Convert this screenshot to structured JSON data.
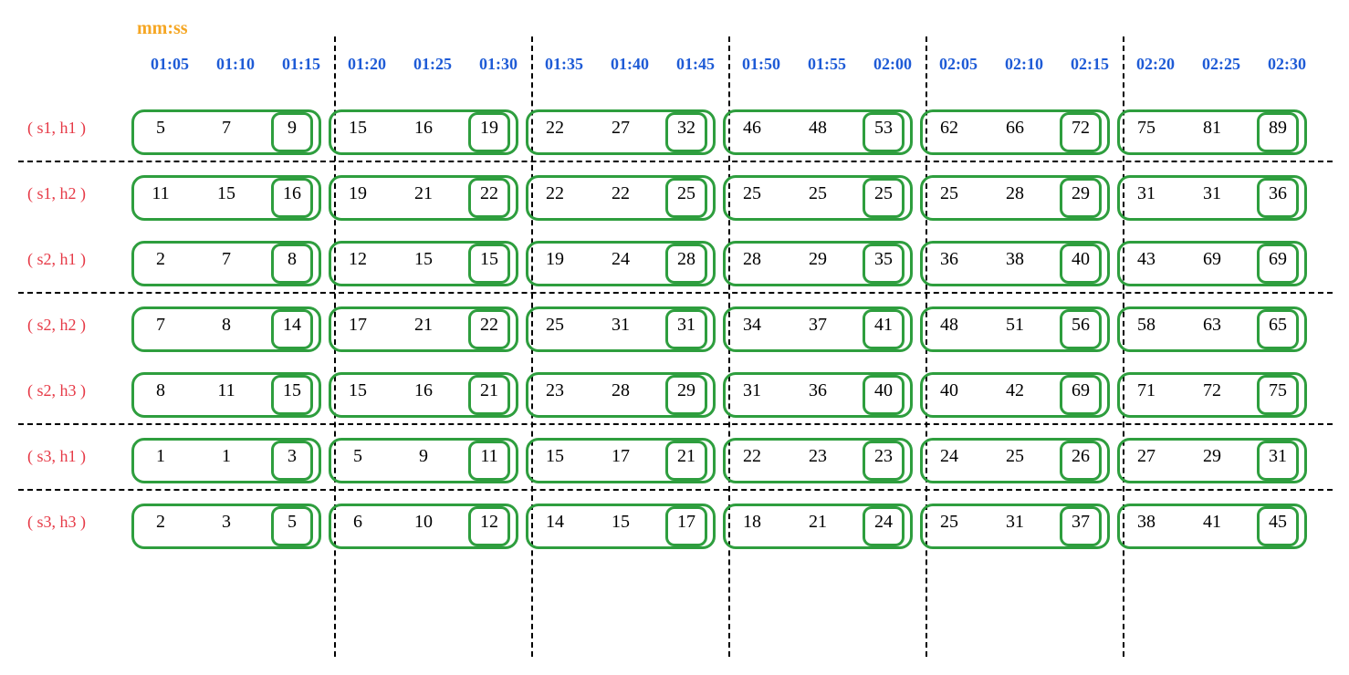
{
  "mmss_label": "mm:ss",
  "chart_data": {
    "type": "table",
    "title": "",
    "time_headers": [
      "01:05",
      "01:10",
      "01:15",
      "01:20",
      "01:25",
      "01:30",
      "01:35",
      "01:40",
      "01:45",
      "01:50",
      "01:55",
      "02:00",
      "02:05",
      "02:10",
      "02:15",
      "02:20",
      "02:25",
      "02:30"
    ],
    "rows": [
      {
        "label": "( s1, h1 )",
        "values": [
          5,
          7,
          9,
          15,
          16,
          19,
          22,
          27,
          32,
          46,
          48,
          53,
          62,
          66,
          72,
          75,
          81,
          89
        ]
      },
      {
        "label": "( s1, h2 )",
        "values": [
          11,
          15,
          16,
          19,
          21,
          22,
          22,
          22,
          25,
          25,
          25,
          25,
          25,
          28,
          29,
          31,
          31,
          36
        ]
      },
      {
        "label": "( s2, h1 )",
        "values": [
          2,
          7,
          8,
          12,
          15,
          15,
          19,
          24,
          28,
          28,
          29,
          35,
          36,
          38,
          40,
          43,
          69,
          69
        ]
      },
      {
        "label": "( s2, h2 )",
        "values": [
          7,
          8,
          14,
          17,
          21,
          22,
          25,
          31,
          31,
          34,
          37,
          41,
          48,
          51,
          56,
          58,
          63,
          65
        ]
      },
      {
        "label": "( s2, h3 )",
        "values": [
          8,
          11,
          15,
          15,
          16,
          21,
          23,
          28,
          29,
          31,
          36,
          40,
          40,
          42,
          69,
          71,
          72,
          75
        ]
      },
      {
        "label": "( s3, h1 )",
        "values": [
          1,
          1,
          3,
          5,
          9,
          11,
          15,
          17,
          21,
          22,
          23,
          23,
          24,
          25,
          26,
          27,
          29,
          31
        ]
      },
      {
        "label": "( s3, h3 )",
        "values": [
          2,
          3,
          5,
          6,
          10,
          12,
          14,
          15,
          17,
          18,
          21,
          24,
          25,
          31,
          37,
          38,
          41,
          45
        ]
      }
    ],
    "group_size": 3,
    "highlighted_column_indices": [
      2,
      5,
      8,
      11,
      14,
      17
    ],
    "horizontal_dividers_after_rows": [
      0,
      2,
      4,
      5
    ],
    "vertical_dividers_after_columns": [
      2,
      5,
      8,
      11,
      14
    ]
  }
}
